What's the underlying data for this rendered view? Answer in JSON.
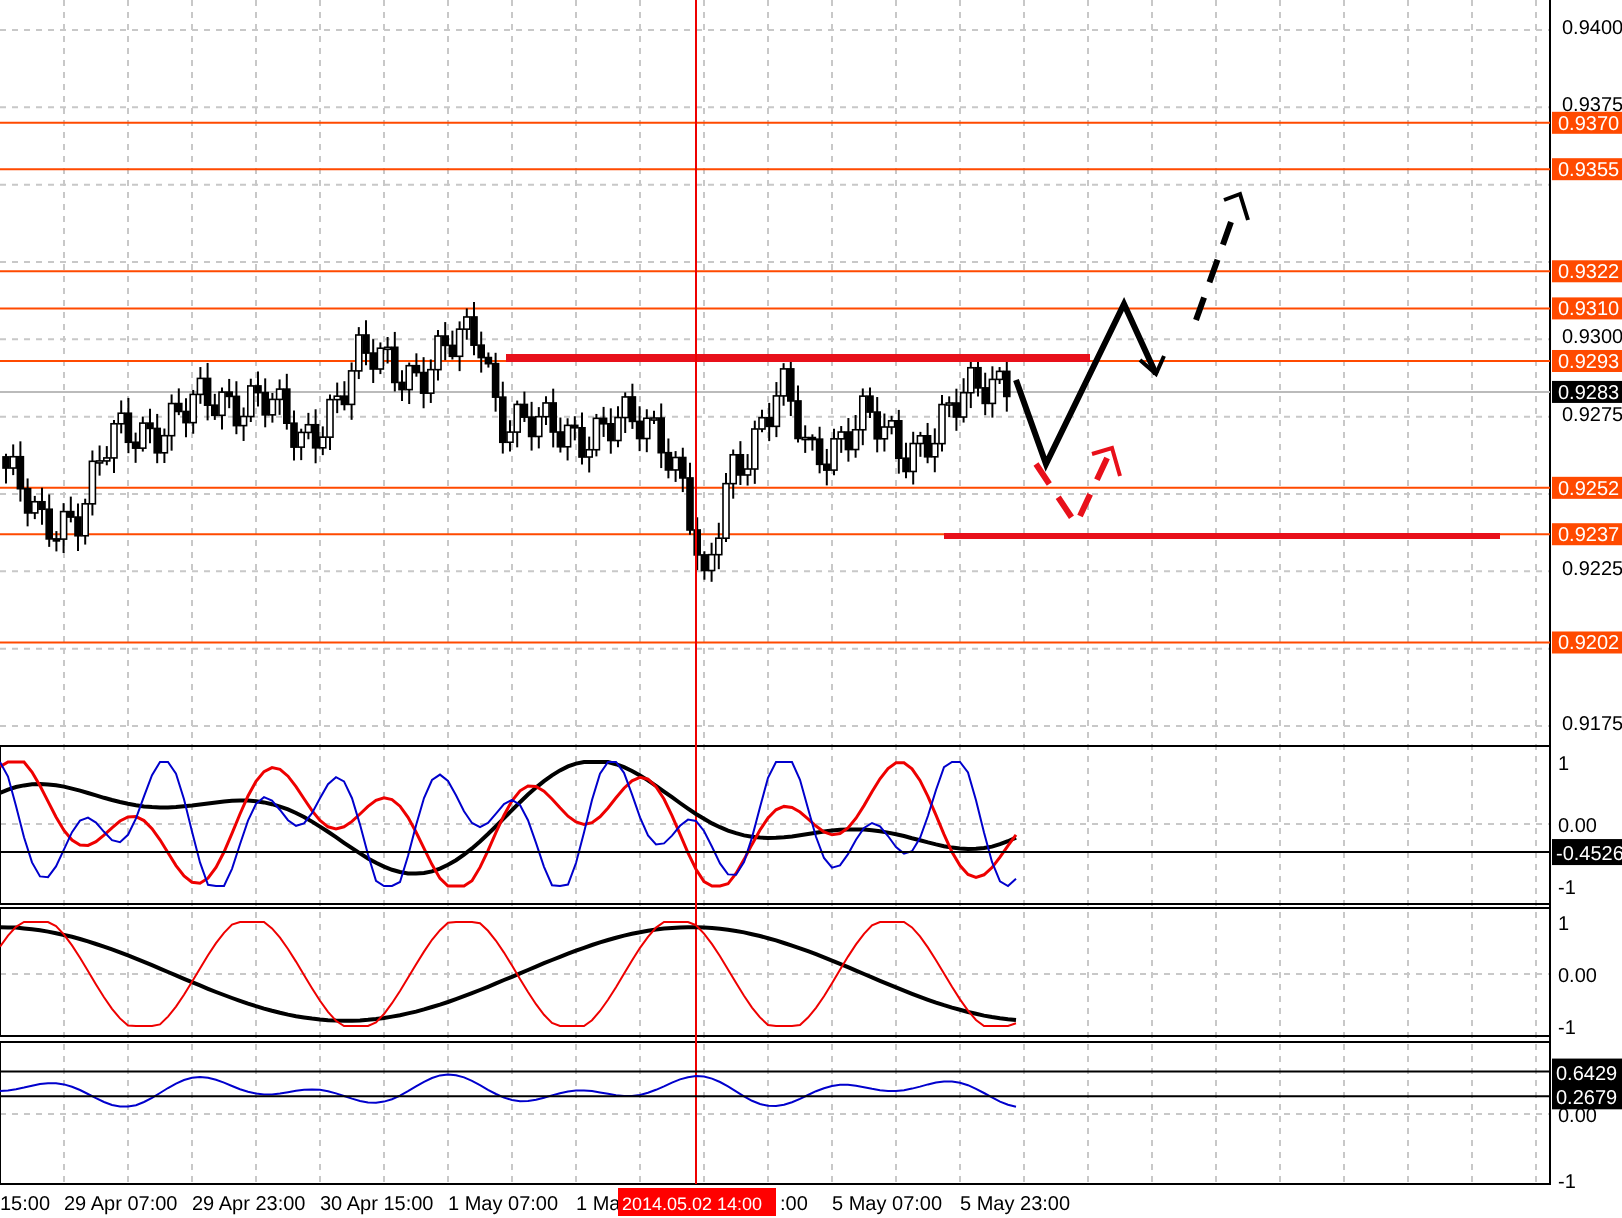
{
  "price_chart": {
    "axis_ticks": [
      "0.9400",
      "0.9375",
      "0.9300",
      "0.9275",
      "0.9225",
      "0.9175"
    ],
    "levels": [
      {
        "label": "0.9370",
        "color": "#ff4a00"
      },
      {
        "label": "0.9355",
        "color": "#ff4a00"
      },
      {
        "label": "0.9322",
        "color": "#ff4a00"
      },
      {
        "label": "0.9310",
        "color": "#ff4a00"
      },
      {
        "label": "0.9293",
        "color": "#ff4a00"
      },
      {
        "label": "0.9283",
        "color": "#000000"
      },
      {
        "label": "0.9252",
        "color": "#ff4a00"
      },
      {
        "label": "0.9237",
        "color": "#ff4a00"
      },
      {
        "label": "0.9202",
        "color": "#ff4a00"
      }
    ]
  },
  "indicators": [
    {
      "axis_ticks": [
        "1",
        "0.00",
        "-1"
      ],
      "value_tags": [
        "-0.4526"
      ]
    },
    {
      "axis_ticks": [
        "1",
        "0.00",
        "-1"
      ]
    },
    {
      "axis_ticks": [
        "0.00",
        "-1"
      ],
      "value_tags": [
        "0.6429",
        "0.2679"
      ]
    }
  ],
  "time_axis": {
    "labels": [
      "15:00",
      "29 Apr 07:00",
      "29 Apr 23:00",
      "30 Apr 15:00",
      "1 May 07:00",
      "1 Ma",
      ":00",
      "5 May 07:00",
      "5 May 23:00"
    ],
    "crosshair_label": "2014.05.02 14:00"
  }
}
